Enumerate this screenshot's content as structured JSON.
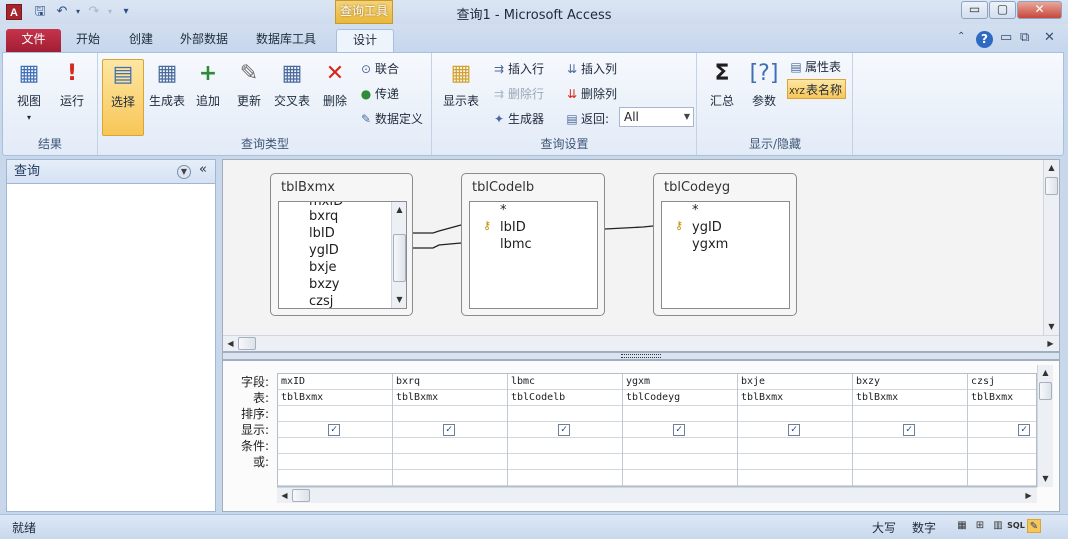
{
  "titlebar": {
    "title": "查询1 - Microsoft Access",
    "context_tab": "查询工具",
    "logo_letter": "A",
    "minimize": "▭",
    "maximize": "▢",
    "close": "✕"
  },
  "tabs": [
    "文件",
    "开始",
    "创建",
    "外部数据",
    "数据库工具",
    "设计"
  ],
  "ribbon": {
    "groups": {
      "results": "结果",
      "query_type": "查询类型",
      "query_setup": "查询设置",
      "show_hide": "显示/隐藏"
    },
    "buttons": {
      "view": "视图",
      "run": "运行",
      "select": "选择",
      "make_table": "生成表",
      "append": "追加",
      "update": "更新",
      "crosstab": "交叉表",
      "delete": "删除",
      "union": "联合",
      "pass_through": "传递",
      "data_definition": "数据定义",
      "show_table": "显示表",
      "insert_rows": "插入行",
      "delete_rows": "删除行",
      "builder": "生成器",
      "insert_columns": "插入列",
      "delete_columns": "删除列",
      "return_label": "返回:",
      "return_value": "All",
      "totals": "汇总",
      "parameters": "参数",
      "property_sheet": "属性表",
      "table_names": "表名称"
    }
  },
  "nav_pane": {
    "title": "查询"
  },
  "tables": [
    {
      "name": "tblBxmx",
      "fields": [
        "mxID",
        "bxrq",
        "lbID",
        "ygID",
        "bxje",
        "bxzy",
        "czsj"
      ]
    },
    {
      "name": "tblCodelb",
      "fields": [
        "*",
        "lbID",
        "lbmc"
      ],
      "key": "lbID"
    },
    {
      "name": "tblCodeyg",
      "fields": [
        "*",
        "ygID",
        "ygxm"
      ],
      "key": "ygID"
    }
  ],
  "grid": {
    "row_labels": [
      "字段:",
      "表:",
      "排序:",
      "显示:",
      "条件:",
      "或:"
    ],
    "columns": [
      {
        "field": "mxID",
        "table": "tblBxmx",
        "show": true
      },
      {
        "field": "bxrq",
        "table": "tblBxmx",
        "show": true
      },
      {
        "field": "lbmc",
        "table": "tblCodelb",
        "show": true
      },
      {
        "field": "ygxm",
        "table": "tblCodeyg",
        "show": true
      },
      {
        "field": "bxje",
        "table": "tblBxmx",
        "show": true
      },
      {
        "field": "bxzy",
        "table": "tblBxmx",
        "show": true
      },
      {
        "field": "czsj",
        "table": "tblBxmx",
        "show": true
      }
    ],
    "check_mark": "✓"
  },
  "statusbar": {
    "status": "就绪",
    "caps": "大写",
    "num": "数字",
    "sql": "SQL"
  },
  "colors": {
    "file_tab": "#a11e34",
    "context_tab": "#e9b83a",
    "selected_button": "#f8c657"
  }
}
